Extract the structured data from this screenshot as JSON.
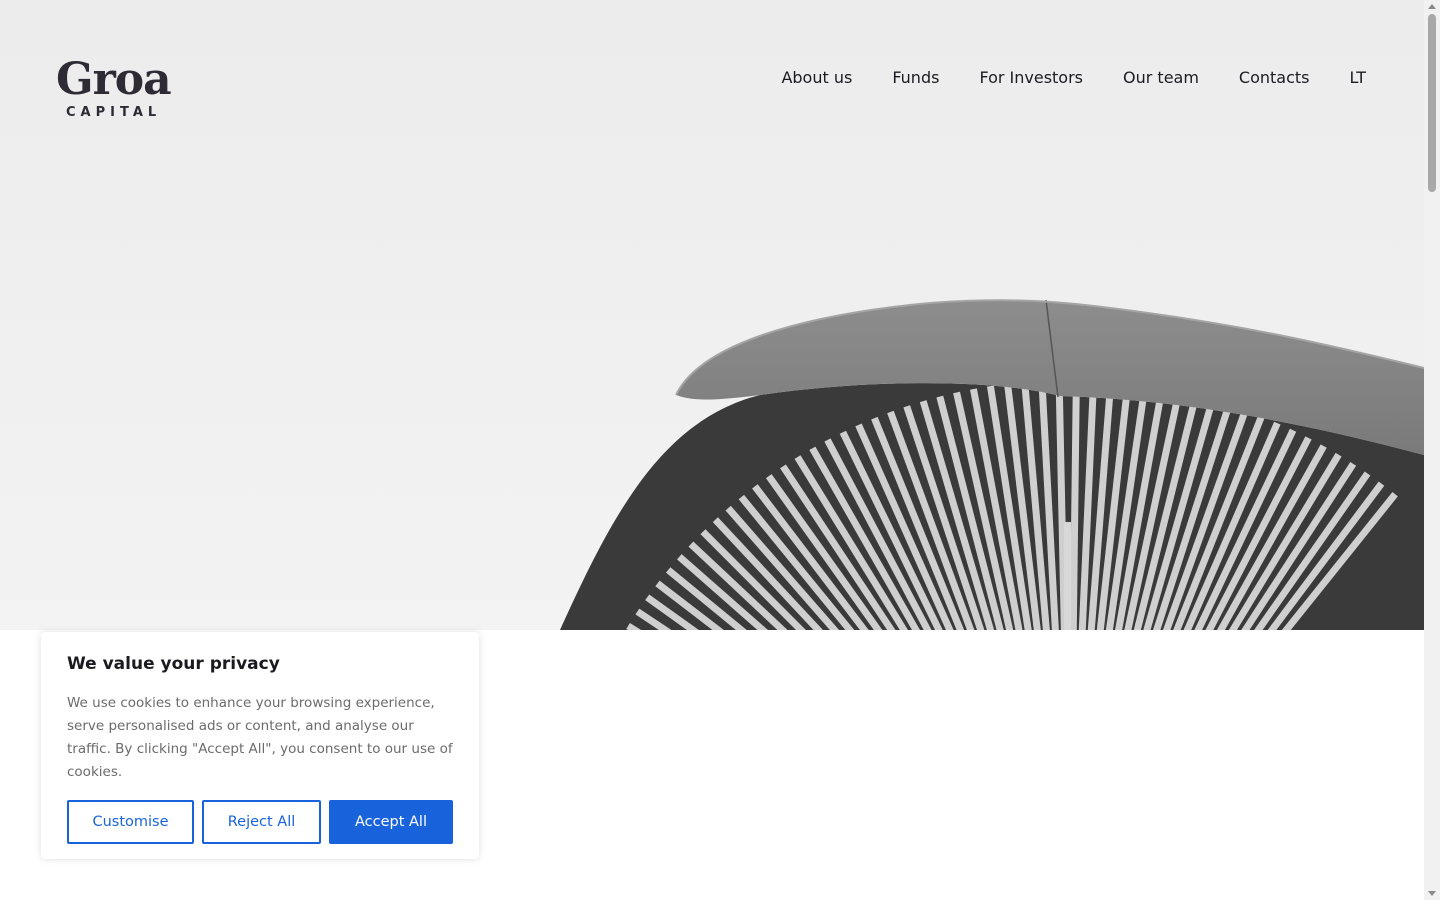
{
  "header": {
    "logo": {
      "wordmark": "Groa",
      "subline": "CAPITAL"
    },
    "nav": [
      {
        "label": "About us"
      },
      {
        "label": "Funds"
      },
      {
        "label": "For Investors"
      },
      {
        "label": "Our team"
      },
      {
        "label": "Contacts"
      },
      {
        "label": "LT"
      }
    ]
  },
  "cookie_banner": {
    "title": "We value your privacy",
    "text": "We use cookies to enhance your browsing experience, serve personalised ads or content, and analyse our traffic. By clicking \"Accept All\", you consent to our use of cookies.",
    "buttons": {
      "customise": "Customise",
      "reject": "Reject All",
      "accept": "Accept All"
    }
  },
  "colors": {
    "accent": "#1863dc",
    "logo": "#2e2b35",
    "text": "#1c1b22"
  }
}
